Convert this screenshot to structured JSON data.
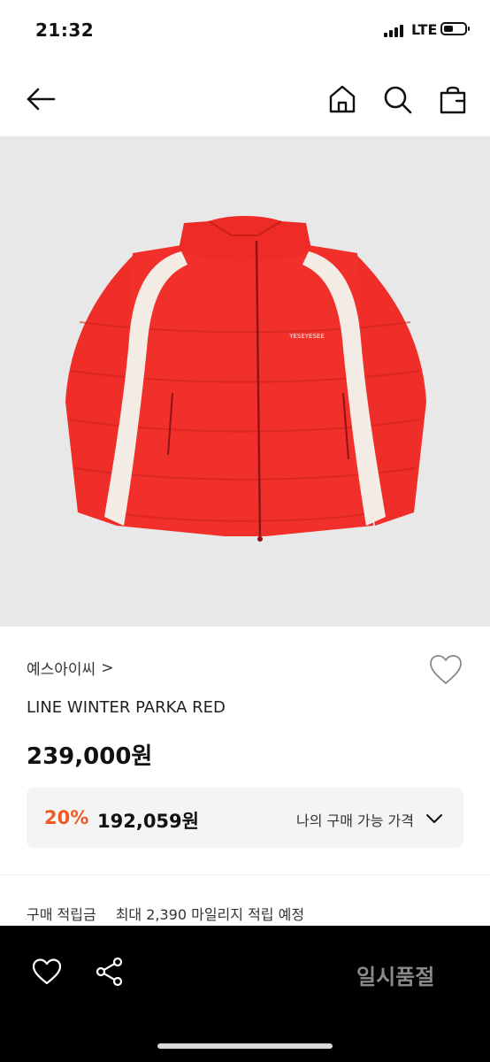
{
  "status_bar": {
    "time": "21:32",
    "network": "LTE"
  },
  "nav": {
    "icons": [
      "back-arrow-icon",
      "home-icon",
      "search-icon",
      "shopping-bag-icon"
    ]
  },
  "product": {
    "brand": "예스아이씨",
    "brand_chevron": ">",
    "name": "LINE WINTER PARKA RED",
    "price": "239,000원",
    "discount": {
      "percent": "20%",
      "price": "192,059원",
      "my_price_label": "나의 구매 가능 가격"
    },
    "points": {
      "label": "구매 적립금",
      "value": "최대 2,390 마일리지 적립 예정"
    },
    "image_label": "YESEYESEE"
  },
  "bottom_bar": {
    "sold_out_label": "일시품절",
    "icons": [
      "heart-icon",
      "share-icon"
    ]
  },
  "colors": {
    "accent": "#ee5a24",
    "jacket_red": "#f2302b",
    "stripe_white": "#f3ece4",
    "image_bg": "#e8e8e8"
  }
}
